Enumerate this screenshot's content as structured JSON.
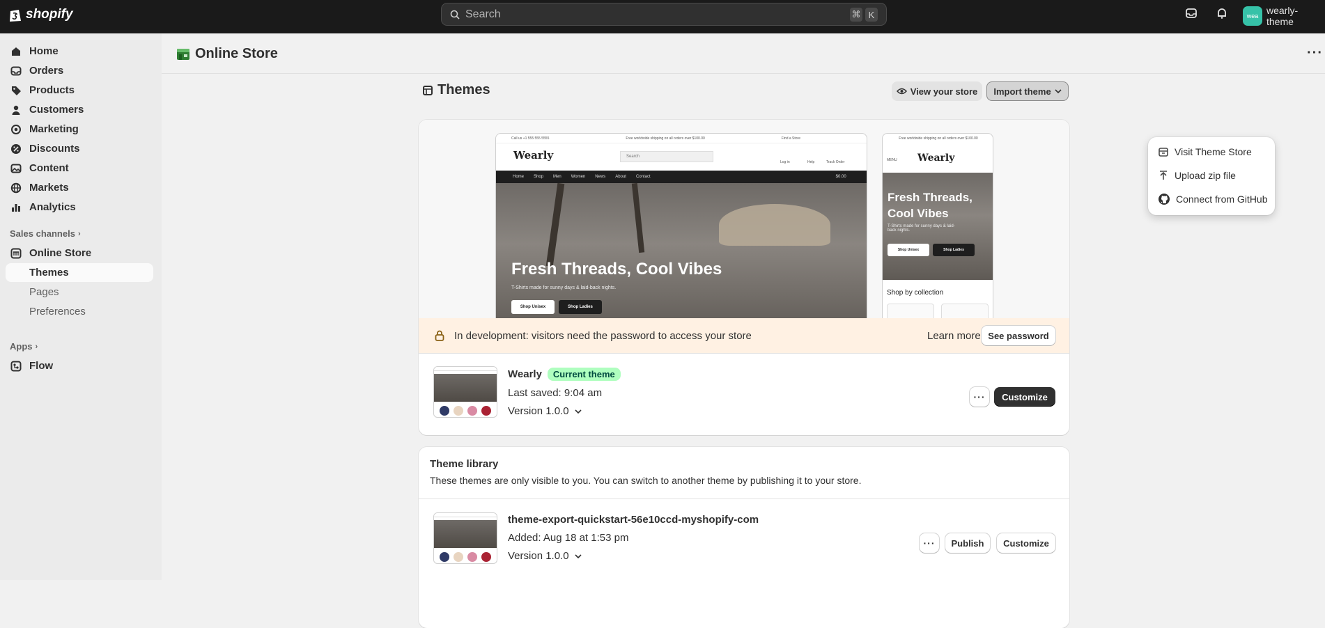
{
  "topbar": {
    "logo_text": "shopify",
    "search_placeholder": "Search",
    "shortcut_cmd": "⌘",
    "shortcut_key": "K",
    "avatar_initials": "wea",
    "store_name": "wearly-theme"
  },
  "sidebar": {
    "items": [
      {
        "label": "Home",
        "icon": "home-icon"
      },
      {
        "label": "Orders",
        "icon": "inbox-icon"
      },
      {
        "label": "Products",
        "icon": "tag-icon"
      },
      {
        "label": "Customers",
        "icon": "person-icon"
      },
      {
        "label": "Marketing",
        "icon": "target-icon"
      },
      {
        "label": "Discounts",
        "icon": "discount-icon"
      },
      {
        "label": "Content",
        "icon": "content-icon"
      },
      {
        "label": "Markets",
        "icon": "globe-icon"
      },
      {
        "label": "Analytics",
        "icon": "bar-chart-icon"
      }
    ],
    "sales_channels_label": "Sales channels",
    "online_store_label": "Online Store",
    "sub_items": [
      "Themes",
      "Pages",
      "Preferences"
    ],
    "apps_label": "Apps",
    "flow_label": "Flow"
  },
  "page": {
    "title": "Online Store",
    "themes_heading": "Themes",
    "view_store_label": "View your store",
    "import_theme_label": "Import theme"
  },
  "import_menu": {
    "items": [
      "Visit Theme Store",
      "Upload zip file",
      "Connect from GitHub"
    ]
  },
  "preview": {
    "announcement": "Call us +1 555 555 5555",
    "shipping_text": "Free worldwide shipping on all orders over $100.00",
    "find_store": "Find a Store",
    "brand": "Wearly",
    "search_text": "Search",
    "icons": [
      "Log in",
      "Help",
      "Track Order"
    ],
    "nav": [
      "Home",
      "Shop",
      "Men",
      "Women",
      "News",
      "About",
      "Contact"
    ],
    "cart_amount": "$0.00",
    "hero_title": "Fresh Threads, Cool Vibes",
    "hero_sub": "T-Shirts made for sunny days & laid-back nights.",
    "btn1": "Shop Unisex",
    "btn2": "Shop Ladies",
    "mobile_menu": "MENU",
    "mobile_title_1": "Fresh Threads,",
    "mobile_title_2": "Cool Vibes",
    "mobile_sub": "T-Shirts made for sunny days & laid-back nights.",
    "collection_heading": "Shop by collection"
  },
  "banner": {
    "text": "In development: visitors need the password to access your store",
    "learn_more": "Learn more",
    "see_password": "See password"
  },
  "current_theme": {
    "name": "Wearly",
    "badge": "Current theme",
    "saved": "Last saved: 9:04 am",
    "version": "Version 1.0.0",
    "customize": "Customize"
  },
  "library": {
    "heading": "Theme library",
    "description": "These themes are only visible to you. You can switch to another theme by publishing it to your store.",
    "themes": [
      {
        "name": "theme-export-quickstart-56e10ccd-myshopify-com",
        "added": "Added: Aug 18 at 1:53 pm",
        "version": "Version 1.0.0",
        "publish": "Publish",
        "customize": "Customize"
      }
    ]
  },
  "colors": {
    "topbar": "#1a1a1a",
    "sidebar": "#ebebeb",
    "badge_bg": "#affebf",
    "banner_bg": "#fff1e3",
    "primary_button": "#303030"
  }
}
